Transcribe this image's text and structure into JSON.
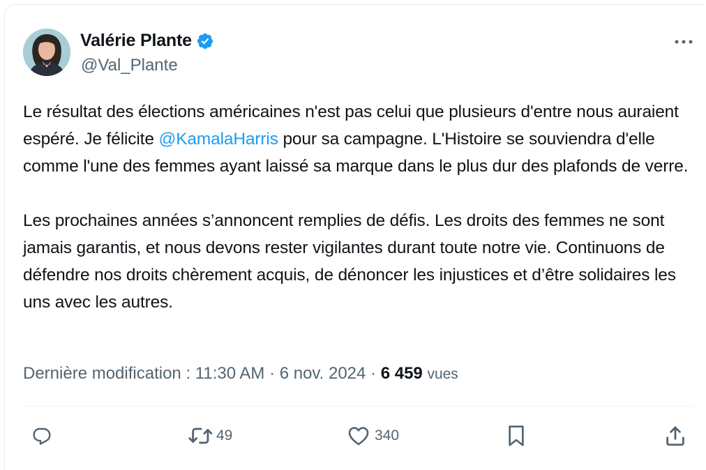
{
  "author": {
    "name": "Valérie Plante",
    "handle": "@Val_Plante",
    "verified": true,
    "avatar_icon": "profile-photo"
  },
  "tweet": {
    "p1_before": "Le résultat des élections américaines n'est pas celui que plusieurs d'entre nous auraient espéré. Je félicite ",
    "mention": "@KamalaHarris",
    "p1_after": " pour sa campagne. L'Histoire se souviendra d'elle comme l'une des femmes ayant laissé sa marque dans le plus dur des plafonds de verre.",
    "p2": "Les prochaines années s’annoncent remplies de défis. Les droits des femmes ne sont jamais garantis, et nous devons rester vigilantes durant toute notre vie. Continuons de défendre nos droits chèrement acquis, de dénoncer les injustices et d’être solidaires les uns avec les autres."
  },
  "meta": {
    "edited_label": "Dernière modification : 11:30 AM · 6 nov. 2024 · ",
    "views_count": "6 459",
    "views_label": "vues"
  },
  "actions": {
    "reply": {
      "icon": "reply-icon",
      "count": ""
    },
    "retweet": {
      "icon": "retweet-icon",
      "count": "49"
    },
    "like": {
      "icon": "heart-icon",
      "count": "340"
    },
    "bookmark": {
      "icon": "bookmark-icon"
    },
    "share": {
      "icon": "share-icon"
    }
  },
  "colors": {
    "accent": "#1d9bf0",
    "text": "#0f1419",
    "secondary": "#536471",
    "divider": "#eff3f4"
  }
}
